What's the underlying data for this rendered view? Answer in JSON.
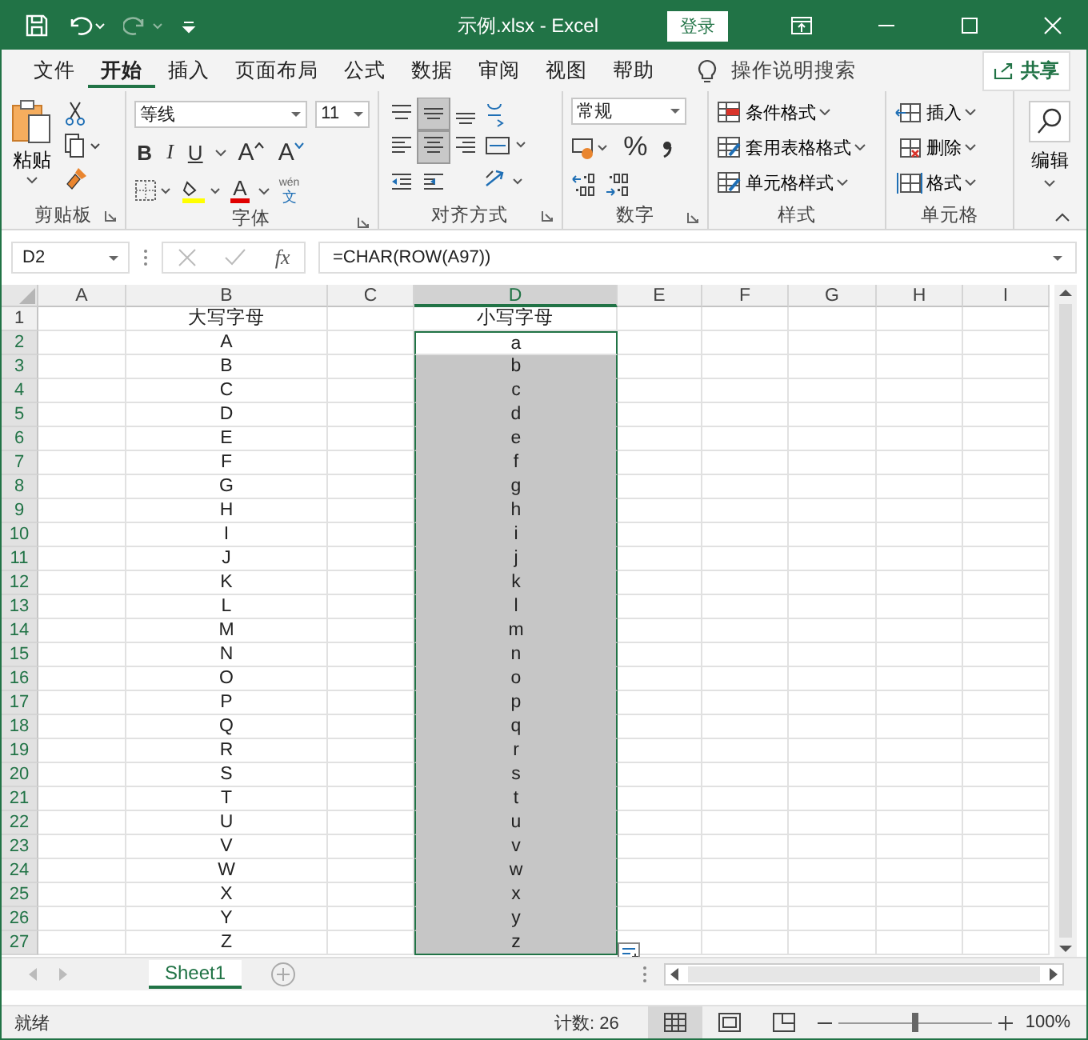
{
  "title_bar": {
    "title": "示例.xlsx  -  Excel",
    "login_button": "登录"
  },
  "menu_tabs": [
    {
      "label": "文件",
      "selected": false
    },
    {
      "label": "开始",
      "selected": true
    },
    {
      "label": "插入",
      "selected": false
    },
    {
      "label": "页面布局",
      "selected": false
    },
    {
      "label": "公式",
      "selected": false
    },
    {
      "label": "数据",
      "selected": false
    },
    {
      "label": "审阅",
      "selected": false
    },
    {
      "label": "视图",
      "selected": false
    },
    {
      "label": "帮助",
      "selected": false
    }
  ],
  "tell_me": "操作说明搜索",
  "share_button": "共享",
  "ribbon": {
    "clipboard": {
      "paste": "粘贴",
      "label": "剪贴板"
    },
    "font": {
      "font_name": "等线",
      "font_size": "11",
      "format_buttons": [
        "B",
        "I",
        "U"
      ],
      "grow": "A",
      "shrink": "A",
      "font_color": "A",
      "phonetic_top": "wén",
      "phonetic_bottom": "文",
      "label": "字体"
    },
    "alignment": {
      "label": "对齐方式"
    },
    "number": {
      "format": "常规",
      "percent": "%",
      "label": "数字"
    },
    "styles": {
      "items": [
        "条件格式",
        "套用表格格式",
        "单元格样式"
      ],
      "label": "样式"
    },
    "cells": {
      "items": [
        "插入",
        "删除",
        "格式"
      ],
      "label": "单元格"
    },
    "editing": {
      "label": "编辑"
    }
  },
  "formula_bar": {
    "name_box": "D2",
    "fx": "fx",
    "formula": "=CHAR(ROW(A97))"
  },
  "sheet": {
    "columns": [
      {
        "label": "A",
        "selected": false
      },
      {
        "label": "B",
        "selected": false
      },
      {
        "label": "C",
        "selected": false
      },
      {
        "label": "D",
        "selected": true
      },
      {
        "label": "E",
        "selected": false
      },
      {
        "label": "F",
        "selected": false
      },
      {
        "label": "G",
        "selected": false
      },
      {
        "label": "H",
        "selected": false
      },
      {
        "label": "I",
        "selected": false
      }
    ],
    "rows": [
      {
        "number": "1",
        "upper": "大写字母",
        "lower": "小写字母",
        "selected": false,
        "active": false
      },
      {
        "number": "2",
        "upper": "A",
        "lower": "a",
        "selected": true,
        "active": true
      },
      {
        "number": "3",
        "upper": "B",
        "lower": "b",
        "selected": true,
        "active": false
      },
      {
        "number": "4",
        "upper": "C",
        "lower": "c",
        "selected": true,
        "active": false
      },
      {
        "number": "5",
        "upper": "D",
        "lower": "d",
        "selected": true,
        "active": false
      },
      {
        "number": "6",
        "upper": "E",
        "lower": "e",
        "selected": true,
        "active": false
      },
      {
        "number": "7",
        "upper": "F",
        "lower": "f",
        "selected": true,
        "active": false
      },
      {
        "number": "8",
        "upper": "G",
        "lower": "g",
        "selected": true,
        "active": false
      },
      {
        "number": "9",
        "upper": "H",
        "lower": "h",
        "selected": true,
        "active": false
      },
      {
        "number": "10",
        "upper": "I",
        "lower": "i",
        "selected": true,
        "active": false
      },
      {
        "number": "11",
        "upper": "J",
        "lower": "j",
        "selected": true,
        "active": false
      },
      {
        "number": "12",
        "upper": "K",
        "lower": "k",
        "selected": true,
        "active": false
      },
      {
        "number": "13",
        "upper": "L",
        "lower": "l",
        "selected": true,
        "active": false
      },
      {
        "number": "14",
        "upper": "M",
        "lower": "m",
        "selected": true,
        "active": false
      },
      {
        "number": "15",
        "upper": "N",
        "lower": "n",
        "selected": true,
        "active": false
      },
      {
        "number": "16",
        "upper": "O",
        "lower": "o",
        "selected": true,
        "active": false
      },
      {
        "number": "17",
        "upper": "P",
        "lower": "p",
        "selected": true,
        "active": false
      },
      {
        "number": "18",
        "upper": "Q",
        "lower": "q",
        "selected": true,
        "active": false
      },
      {
        "number": "19",
        "upper": "R",
        "lower": "r",
        "selected": true,
        "active": false
      },
      {
        "number": "20",
        "upper": "S",
        "lower": "s",
        "selected": true,
        "active": false
      },
      {
        "number": "21",
        "upper": "T",
        "lower": "t",
        "selected": true,
        "active": false
      },
      {
        "number": "22",
        "upper": "U",
        "lower": "u",
        "selected": true,
        "active": false
      },
      {
        "number": "23",
        "upper": "V",
        "lower": "v",
        "selected": true,
        "active": false
      },
      {
        "number": "24",
        "upper": "W",
        "lower": "w",
        "selected": true,
        "active": false
      },
      {
        "number": "25",
        "upper": "X",
        "lower": "x",
        "selected": true,
        "active": false
      },
      {
        "number": "26",
        "upper": "Y",
        "lower": "y",
        "selected": true,
        "active": false
      },
      {
        "number": "27",
        "upper": "Z",
        "lower": "z",
        "selected": true,
        "active": false
      }
    ]
  },
  "sheet_tabs": [
    {
      "label": "Sheet1",
      "selected": true
    }
  ],
  "status_bar": {
    "status": "就绪",
    "count": "计数: 26",
    "views": [
      {
        "kind": "normal",
        "selected": true
      },
      {
        "kind": "page_layout",
        "selected": false
      },
      {
        "kind": "page_break",
        "selected": false
      }
    ],
    "zoom": {
      "level": 0.5,
      "reading": "100%"
    }
  }
}
